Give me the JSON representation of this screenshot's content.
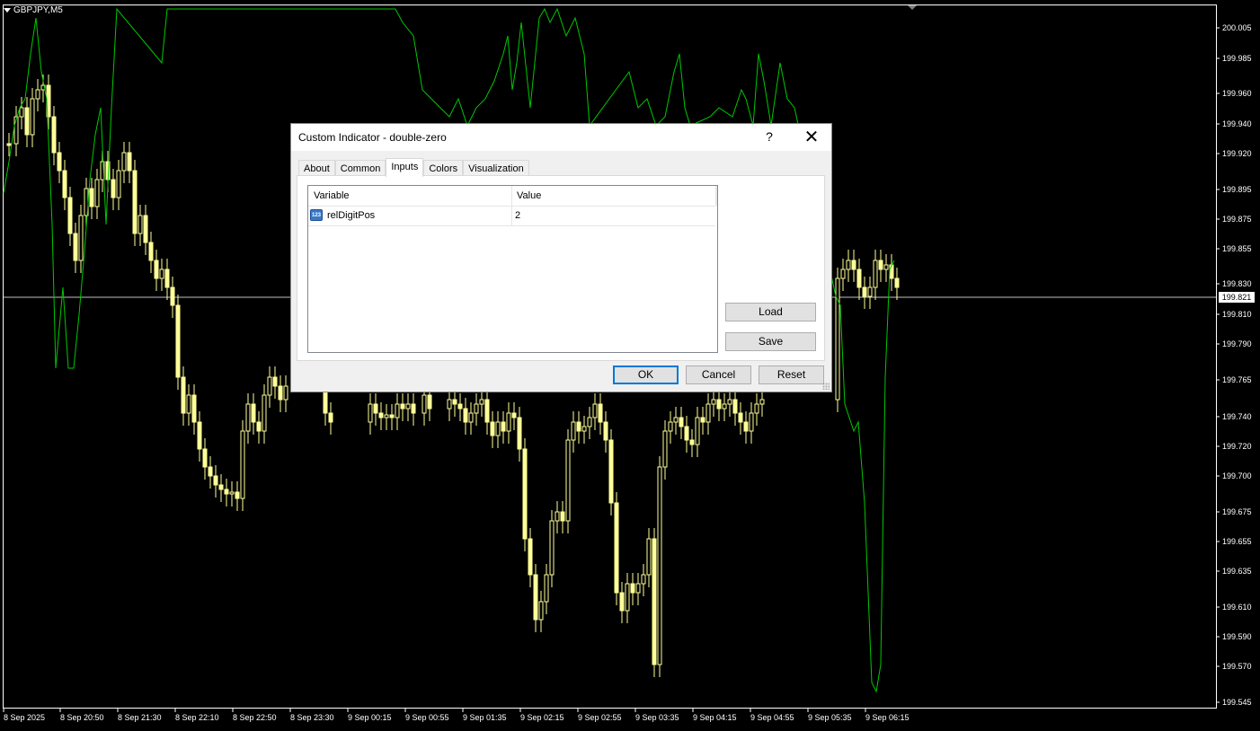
{
  "chart": {
    "symbol": "GBPJPY,M5",
    "current_price": "199.821",
    "price_axis": [
      "200.005",
      "199.985",
      "199.960",
      "199.940",
      "199.920",
      "199.895",
      "199.875",
      "199.855",
      "199.830",
      "199.810",
      "199.790",
      "199.765",
      "199.740",
      "199.720",
      "199.700",
      "199.675",
      "199.655",
      "199.635",
      "199.610",
      "199.590",
      "199.570",
      "199.545"
    ],
    "time_axis": [
      "8 Sep 2025",
      "8 Sep 20:50",
      "8 Sep 21:30",
      "8 Sep 22:10",
      "8 Sep 22:50",
      "8 Sep 23:30",
      "9 Sep 00:15",
      "9 Sep 00:55",
      "9 Sep 01:35",
      "9 Sep 02:15",
      "9 Sep 02:55",
      "9 Sep 03:35",
      "9 Sep 04:15",
      "9 Sep 04:55",
      "9 Sep 05:35",
      "9 Sep 06:15"
    ],
    "colors": {
      "background": "#000000",
      "candle": "#ffff99",
      "indicator": "#00c800",
      "grid": "#ffffff",
      "price_line": "#c0c0c0"
    }
  },
  "dialog": {
    "title": "Custom Indicator - double-zero",
    "help": "?",
    "close": "✕",
    "tabs": [
      "About",
      "Common",
      "Inputs",
      "Colors",
      "Visualization"
    ],
    "active_tab": "Inputs",
    "table": {
      "headers": [
        "Variable",
        "Value"
      ],
      "rows": [
        {
          "icon": "123",
          "variable": "relDigitPos",
          "value": "2"
        }
      ]
    },
    "buttons": {
      "load": "Load",
      "save": "Save",
      "ok": "OK",
      "cancel": "Cancel",
      "reset": "Reset"
    }
  }
}
